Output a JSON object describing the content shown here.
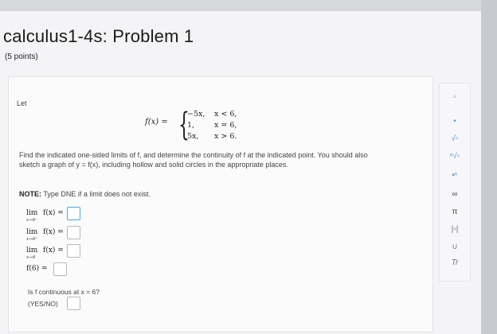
{
  "title": "calculus1-4s: Problem 1",
  "points": "(5 points)",
  "let": "Let",
  "function": {
    "lhs": "f(x) =",
    "cases": [
      {
        "expr": "−5x,",
        "cond": "x < 6,"
      },
      {
        "expr": "1,",
        "cond": "x = 6,"
      },
      {
        "expr": "5x,",
        "cond": "x > 6."
      }
    ]
  },
  "instructions": "Find the indicated one-sided limits of f, and determine the continuity of f at the indicated point. You should also sketch a graph of y = f(x), including hollow and solid circles in the appropriate places.",
  "note_label": "NOTE:",
  "note_text": " Type DNE if a limit does not exist.",
  "limits": [
    {
      "top": "lim",
      "sub": "x→6⁻",
      "expr": "f(x) ="
    },
    {
      "top": "lim",
      "sub": "x→6⁺",
      "expr": "f(x) ="
    },
    {
      "top": "lim",
      "sub": "x→6",
      "expr": "f(x) ="
    },
    {
      "top": "",
      "sub": "",
      "expr": "f(6) ="
    }
  ],
  "question": "Is f continuous at x = 6?",
  "question_choices": "(YES/NO)",
  "palette": [
    {
      "icon": "fraction-icon",
      "glyph": "▫"
    },
    {
      "icon": "mixed-number-icon",
      "glyph": "▪"
    },
    {
      "icon": "sqrt-icon",
      "glyph": "√▫"
    },
    {
      "icon": "nth-root-icon",
      "glyph": "ⁿ√▫"
    },
    {
      "icon": "exponent-icon",
      "glyph": "▪ⁿ"
    },
    {
      "icon": "infinity-icon",
      "glyph": "∞"
    },
    {
      "icon": "pi-icon",
      "glyph": "π"
    },
    {
      "icon": "absolute-value-icon",
      "glyph": "|▫|"
    },
    {
      "icon": "union-icon",
      "glyph": "∪"
    },
    {
      "icon": "text-icon",
      "glyph": "Tr"
    }
  ]
}
